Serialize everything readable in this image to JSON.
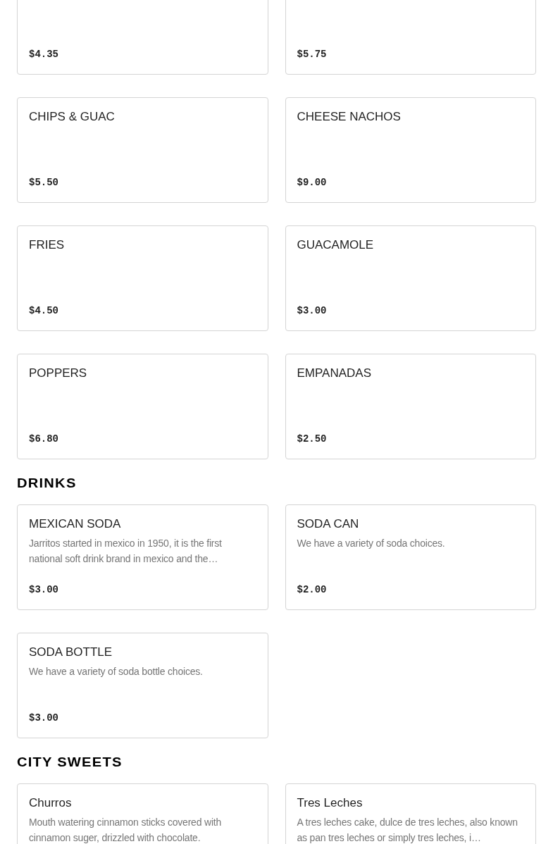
{
  "sections": [
    {
      "items": [
        {
          "price": "$4.35"
        },
        {
          "price": "$5.75"
        },
        {
          "name": "CHIPS & GUAC",
          "price": "$5.50"
        },
        {
          "name": "CHEESE NACHOS",
          "price": "$9.00"
        },
        {
          "name": "FRIES",
          "price": "$4.50"
        },
        {
          "name": "GUACAMOLE",
          "price": "$3.00"
        },
        {
          "name": "POPPERS",
          "price": "$6.80"
        },
        {
          "name": "EMPANADAS",
          "price": "$2.50"
        }
      ]
    },
    {
      "title": "DRINKS",
      "items": [
        {
          "name": "MEXICAN SODA",
          "description": "Jarritos started in mexico in 1950, it is the first national soft drink brand in mexico and the…",
          "price": "$3.00"
        },
        {
          "name": "SODA CAN",
          "description": "We have a variety of soda choices.",
          "price": "$2.00"
        },
        {
          "name": "SODA BOTTLE",
          "description": "We have a variety of soda bottle choices.",
          "price": "$3.00"
        }
      ]
    },
    {
      "title": "CITY SWEETS",
      "items": [
        {
          "name": "Churros",
          "description": "Mouth watering cinnamon sticks covered with cinnamon suger, drizzled with chocolate."
        },
        {
          "name": "Tres Leches",
          "description": "A tres leches cake, dulce de tres leches, also known as pan tres leches or simply tres leches, i…"
        }
      ]
    }
  ]
}
